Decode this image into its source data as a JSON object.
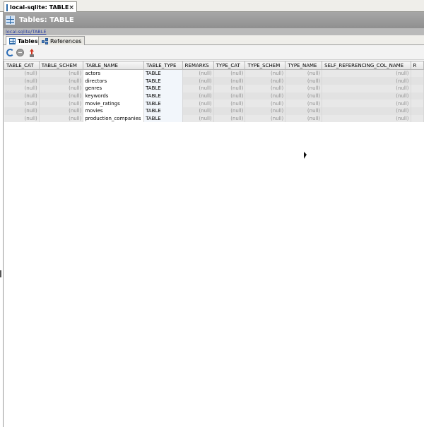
{
  "editor_tab": {
    "label": "local-sqlite: TABLE",
    "close_glyph": "×",
    "icon": "table-icon"
  },
  "title_bar": {
    "title": "Tables: TABLE",
    "icon": "table-icon"
  },
  "breadcrumb": "local-sqlite/TABLE",
  "sub_tabs": [
    {
      "label": "Tables",
      "active": true,
      "icon": "table-icon"
    },
    {
      "label": "References",
      "active": false,
      "icon": "references-icon"
    }
  ],
  "toolbar": {
    "icons": [
      "refresh-icon",
      "stop-icon",
      "export-icon"
    ]
  },
  "table": {
    "columns": [
      "TABLE_CAT",
      "TABLE_SCHEM",
      "TABLE_NAME",
      "TABLE_TYPE",
      "REMARKS",
      "TYPE_CAT",
      "TYPE_SCHEM",
      "TYPE_NAME",
      "SELF_REFERENCING_COL_NAME",
      "R"
    ],
    "rows": [
      [
        "(null)",
        "(null)",
        "actors",
        "TABLE",
        "(null)",
        "(null)",
        "(null)",
        "(null)",
        "(null)",
        ""
      ],
      [
        "(null)",
        "(null)",
        "directors",
        "TABLE",
        "(null)",
        "(null)",
        "(null)",
        "(null)",
        "(null)",
        ""
      ],
      [
        "(null)",
        "(null)",
        "genres",
        "TABLE",
        "(null)",
        "(null)",
        "(null)",
        "(null)",
        "(null)",
        ""
      ],
      [
        "(null)",
        "(null)",
        "keywords",
        "TABLE",
        "(null)",
        "(null)",
        "(null)",
        "(null)",
        "(null)",
        ""
      ],
      [
        "(null)",
        "(null)",
        "movie_ratings",
        "TABLE",
        "(null)",
        "(null)",
        "(null)",
        "(null)",
        "(null)",
        ""
      ],
      [
        "(null)",
        "(null)",
        "movies",
        "TABLE",
        "(null)",
        "(null)",
        "(null)",
        "(null)",
        "(null)",
        ""
      ],
      [
        "(null)",
        "(null)",
        "production_companies",
        "TABLE",
        "(null)",
        "(null)",
        "(null)",
        "(null)",
        "(null)",
        ""
      ]
    ]
  },
  "colors": {
    "title_bar": "#9a9a9a",
    "null_cell": "#e8e8e8",
    "link": "#2a3fa3"
  }
}
